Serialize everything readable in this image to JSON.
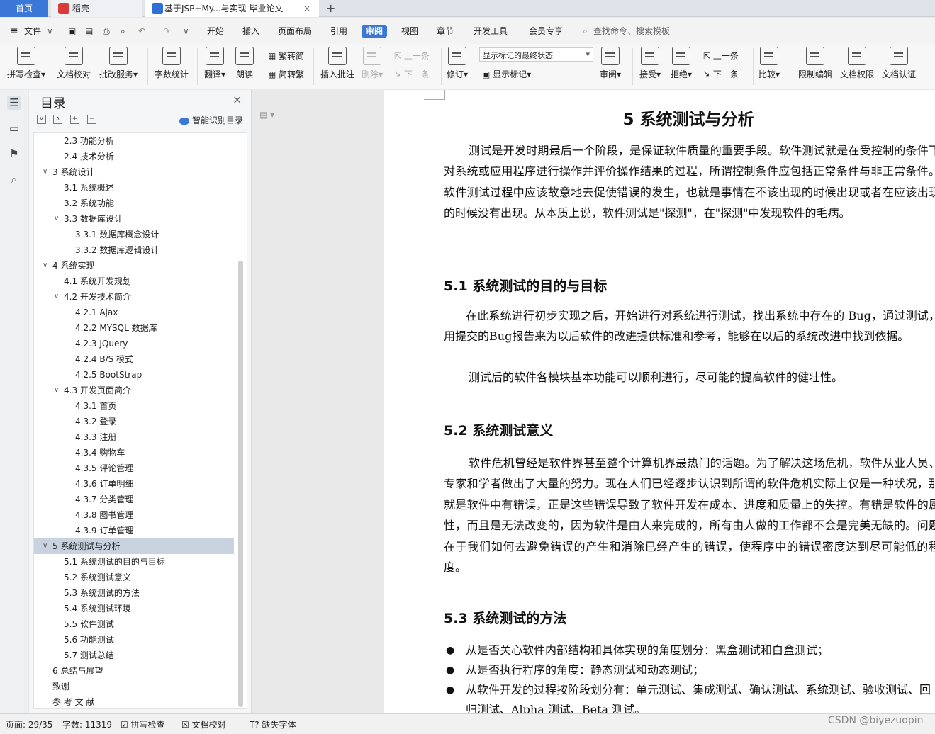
{
  "tabs": {
    "home": "首页",
    "daoke": "稻壳",
    "doc": "基于JSP+My...与实现 毕业论文",
    "new": "+"
  },
  "menu": {
    "file": "文件",
    "items": [
      "开始",
      "插入",
      "页面布局",
      "引用",
      "审阅",
      "视图",
      "章节",
      "开发工具",
      "会员专享"
    ],
    "active": "审阅",
    "search": "查找命令、搜索模板"
  },
  "ribbon": {
    "spell": "拼写检查",
    "proof": "文档校对",
    "annot": "批改服务",
    "wordcount": "字数统计",
    "translate": "翻译",
    "read": "朗读",
    "trad": "繁转简",
    "simp": "简转繁",
    "insert_comment": "插入批注",
    "delete": "删除",
    "prev": "上一条",
    "next": "下一条",
    "revise": "修订",
    "markup_state": "显示标记的最终状态",
    "show_markup": "显示标记",
    "review": "审阅",
    "accept": "接受",
    "reject": "拒绝",
    "prev2": "上一条",
    "next2": "下一条",
    "compare": "比较",
    "restrict": "限制编辑",
    "perm": "文档权限",
    "auth": "文档认证"
  },
  "toc": {
    "title": "目录",
    "smart": "智能识别目录",
    "items": [
      {
        "text": "2.3 功能分析",
        "level": 2
      },
      {
        "text": "2.4 技术分析",
        "level": 2
      },
      {
        "text": "3 系统设计",
        "level": 1,
        "arrow": "∨"
      },
      {
        "text": "3.1 系统概述",
        "level": 2
      },
      {
        "text": "3.2 系统功能",
        "level": 2
      },
      {
        "text": "3.3 数据库设计",
        "level": 2,
        "arrow": "∨"
      },
      {
        "text": "3.3.1 数据库概念设计",
        "level": 3
      },
      {
        "text": "3.3.2 数据库逻辑设计",
        "level": 3
      },
      {
        "text": "4 系统实现",
        "level": 1,
        "arrow": "∨"
      },
      {
        "text": "4.1 系统开发规划",
        "level": 2
      },
      {
        "text": "4.2 开发技术简介",
        "level": 2,
        "arrow": "∨"
      },
      {
        "text": "4.2.1 Ajax",
        "level": 3
      },
      {
        "text": "4.2.2 MYSQL 数据库",
        "level": 3
      },
      {
        "text": "4.2.3 JQuery",
        "level": 3
      },
      {
        "text": "4.2.4 B/S 模式",
        "level": 3
      },
      {
        "text": "4.2.5 BootStrap",
        "level": 3
      },
      {
        "text": "4.3 开发页面简介",
        "level": 2,
        "arrow": "∨"
      },
      {
        "text": "4.3.1 首页",
        "level": 3
      },
      {
        "text": "4.3.2 登录",
        "level": 3
      },
      {
        "text": "4.3.3 注册",
        "level": 3
      },
      {
        "text": "4.3.4 购物车",
        "level": 3
      },
      {
        "text": "4.3.5 评论管理",
        "level": 3
      },
      {
        "text": "4.3.6 订单明细",
        "level": 3
      },
      {
        "text": "4.3.7 分类管理",
        "level": 3
      },
      {
        "text": "4.3.8 图书管理",
        "level": 3
      },
      {
        "text": "4.3.9 订单管理",
        "level": 3
      },
      {
        "text": "5 系统测试与分析",
        "level": 1,
        "arrow": "∨",
        "selected": true
      },
      {
        "text": "5.1 系统测试的目的与目标",
        "level": 2
      },
      {
        "text": "5.2 系统测试意义",
        "level": 2
      },
      {
        "text": "5.3 系统测试的方法",
        "level": 2
      },
      {
        "text": "5.4 系统测试环境",
        "level": 2
      },
      {
        "text": "5.5 软件测试",
        "level": 2
      },
      {
        "text": "5.6 功能测试",
        "level": 2
      },
      {
        "text": "5.7 测试总结",
        "level": 2
      },
      {
        "text": "6 总结与展望",
        "level": 1
      },
      {
        "text": "致谢",
        "level": 1
      },
      {
        "text": "参 考 文 献",
        "level": 1
      }
    ]
  },
  "doc": {
    "h1": "5  系统测试与分析",
    "p1": "测试是开发时期最后一个阶段，是保证软件质量的重要手段。软件测试就是在受控制的条件下对系统或应用程序进行操作并评价操作结果的过程，所谓控制条件应包括正常条件与非正常条件。软件测试过程中应该故意地去促使错误的发生，也就是事情在不该出现的时候出现或者在应该出现的时候没有出现。从本质上说，软件测试是\"探测\"，在\"探测\"中发现软件的毛病。",
    "h2_1": "5.1  系统测试的目的与目标",
    "p2": "在此系统进行初步实现之后，开始进行对系统进行测试，找出系统中存在的 Bug，通过测试，用提交的Bug报告来为以后软件的改进提供标准和参考，能够在以后的系统改进中找到依据。",
    "p3": "测试后的软件各模块基本功能可以顺利进行，尽可能的提高软件的健壮性。",
    "h2_2": "5.2  系统测试意义",
    "p4": "软件危机曾经是软件界甚至整个计算机界最热门的话题。为了解决这场危机，软件从业人员、专家和学者做出了大量的努力。现在人们已经逐步认识到所谓的软件危机实际上仅是一种状况，那就是软件中有错误，正是这些错误导致了软件开发在成本、进度和质量上的失控。有错是软件的属性，而且是无法改变的，因为软件是由人来完成的，所有由人做的工作都不会是完美无缺的。问题在于我们如何去避免错误的产生和消除已经产生的错误，使程序中的错误密度达到尽可能低的程度。",
    "h2_3": "5.3  系统测试的方法",
    "bullets": [
      "从是否关心软件内部结构和具体实现的角度划分：黑盒测试和白盒测试；",
      "从是否执行程序的角度：静态测试和动态测试；",
      "从软件开发的过程按阶段划分有：单元测试、集成测试、确认测试、系统测试、验收测试、回归测试、Alpha 测试、Beta 测试。"
    ]
  },
  "status": {
    "page": "页面: 29/35",
    "words": "字数: 11319",
    "spell": "拼写检查",
    "proof": "文档校对",
    "missing_font": "缺失字体"
  },
  "watermark": "CSDN @biyezuopin"
}
